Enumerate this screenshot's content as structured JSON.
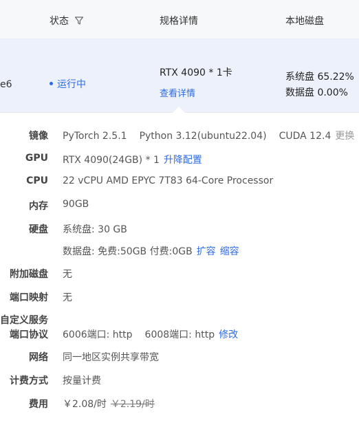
{
  "header": {
    "status_label": "状态",
    "spec_label": "规格详情",
    "disk_label": "本地磁盘"
  },
  "row": {
    "id_fragment": "e6",
    "status": "运行中",
    "spec": "RTX 4090 * 1卡",
    "view_detail": "查看详情",
    "system_disk": "系统盘 65.22%",
    "data_disk": "数据盘 0.00%"
  },
  "details": {
    "image_label": "镜像",
    "image_pytorch": "PyTorch  2.5.1",
    "image_python": "Python  3.12(ubuntu22.04)",
    "image_cuda": "CUDA  12.4",
    "image_change": "更换",
    "gpu_label": "GPU",
    "gpu_value": "RTX 4090(24GB) * 1",
    "gpu_upgrade": "升降配置",
    "cpu_label": "CPU",
    "cpu_value": "22 vCPU AMD EPYC 7T83 64-Core Processor",
    "mem_label": "内存",
    "mem_value": "90GB",
    "disk_label": "硬盘",
    "disk_system": "系统盘:  30 GB",
    "disk_data": "数据盘:  免费:50GB   付费:0GB",
    "disk_expand": "扩容",
    "disk_shrink": "缩容",
    "extra_disk_label": "附加磁盘",
    "extra_disk_value": "无",
    "port_map_label": "端口映射",
    "port_map_value": "无",
    "custom_service_label": "自定义服务",
    "port_protocol_label": "端口协议",
    "port_6006": "6006端口:  http",
    "port_6008": "6008端口:  http",
    "port_modify": "修改",
    "network_label": "网络",
    "network_value": "同一地区实例共享带宽",
    "billing_label": "计费方式",
    "billing_value": "按量计费",
    "fee_label": "费用",
    "fee_current": "￥2.08/时",
    "fee_original": "￥2.19/时"
  },
  "colors": {
    "link": "#2e6be6",
    "row_bg": "#edf1fb",
    "header_bg": "#f7f8fa"
  }
}
